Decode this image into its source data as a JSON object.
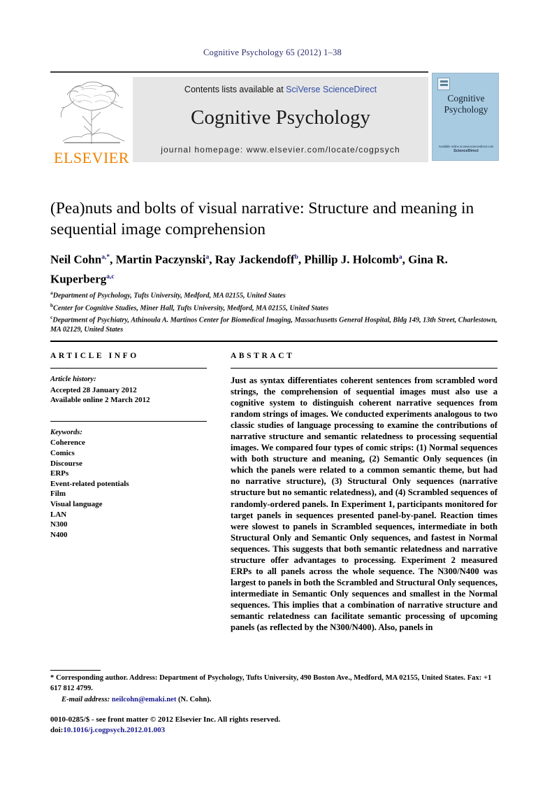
{
  "running_head": "Cognitive Psychology 65 (2012) 1–38",
  "masthead": {
    "contents_prefix": "Contents lists available at ",
    "sciencedirect": "SciVerse ScienceDirect",
    "journal_name": "Cognitive Psychology",
    "homepage": "journal homepage: www.elsevier.com/locate/cogpsych",
    "publisher": "ELSEVIER",
    "publisher_logo": "elsevier-tree-logo"
  },
  "cover": {
    "title_line1": "Cognitive",
    "title_line2": "Psychology",
    "footer_small": "Available online at www.sciencedirect.com",
    "footer_brand": "ScienceDirect",
    "background_color": "#a8cbe2"
  },
  "article": {
    "title": "(Pea)nuts and bolts of visual narrative: Structure and meaning in sequential image comprehension",
    "authors": [
      {
        "name": "Neil Cohn",
        "marks": "a,*"
      },
      {
        "name": "Martin Paczynski",
        "marks": "a"
      },
      {
        "name": "Ray Jackendoff",
        "marks": "b"
      },
      {
        "name": "Phillip J. Holcomb",
        "marks": "a"
      },
      {
        "name": "Gina R. Kuperberg",
        "marks": "a,c"
      }
    ],
    "affiliations": [
      {
        "mark": "a",
        "text": "Department of Psychology, Tufts University, Medford, MA 02155, United States"
      },
      {
        "mark": "b",
        "text": "Center for Cognitive Studies, Miner Hall, Tufts University, Medford, MA 02155, United States"
      },
      {
        "mark": "c",
        "text": "Department of Psychiatry, Athinoula A. Martinos Center for Biomedical Imaging, Massachusetts General Hospital, Bldg 149, 13th Street, Charlestown, MA 02129, United States"
      }
    ]
  },
  "info": {
    "heading": "ARTICLE INFO",
    "history_label": "Article history:",
    "history": [
      "Accepted 28 January 2012",
      "Available online 2 March 2012"
    ],
    "keywords_label": "Keywords:",
    "keywords": [
      "Coherence",
      "Comics",
      "Discourse",
      "ERPs",
      "Event-related potentials",
      "Film",
      "Visual language",
      "LAN",
      "N300",
      "N400"
    ]
  },
  "abstract": {
    "heading": "ABSTRACT",
    "text": "Just as syntax differentiates coherent sentences from scrambled word strings, the comprehension of sequential images must also use a cognitive system to distinguish coherent narrative sequences from random strings of images. We conducted experiments analogous to two classic studies of language processing to examine the contributions of narrative structure and semantic relatedness to processing sequential images. We compared four types of comic strips: (1) Normal sequences with both structure and meaning, (2) Semantic Only sequences (in which the panels were related to a common semantic theme, but had no narrative structure), (3) Structural Only sequences (narrative structure but no semantic relatedness), and (4) Scrambled sequences of randomly-ordered panels. In Experiment 1, participants monitored for target panels in sequences presented panel-by-panel. Reaction times were slowest to panels in Scrambled sequences, intermediate in both Structural Only and Semantic Only sequences, and fastest in Normal sequences. This suggests that both semantic relatedness and narrative structure offer advantages to processing. Experiment 2 measured ERPs to all panels across the whole sequence. The N300/N400 was largest to panels in both the Scrambled and Structural Only sequences, intermediate in Semantic Only sequences and smallest in the Normal sequences. This implies that a combination of narrative structure and semantic relatedness can facilitate semantic processing of upcoming panels (as reflected by the N300/N400). Also, panels in"
  },
  "footnotes": {
    "corresponding": "* Corresponding author. Address: Department of Psychology, Tufts University, 490 Boston Ave., Medford, MA 02155, United States. Fax: +1 617 812 4799.",
    "email_label": "E-mail address:",
    "email": "neilcohn@emaki.net",
    "email_suffix": "(N. Cohn)."
  },
  "footer": {
    "issn_line": "0010-0285/$ - see front matter © 2012 Elsevier Inc. All rights reserved.",
    "doi_label": "doi:",
    "doi": "10.1016/j.cogpsych.2012.01.003"
  }
}
